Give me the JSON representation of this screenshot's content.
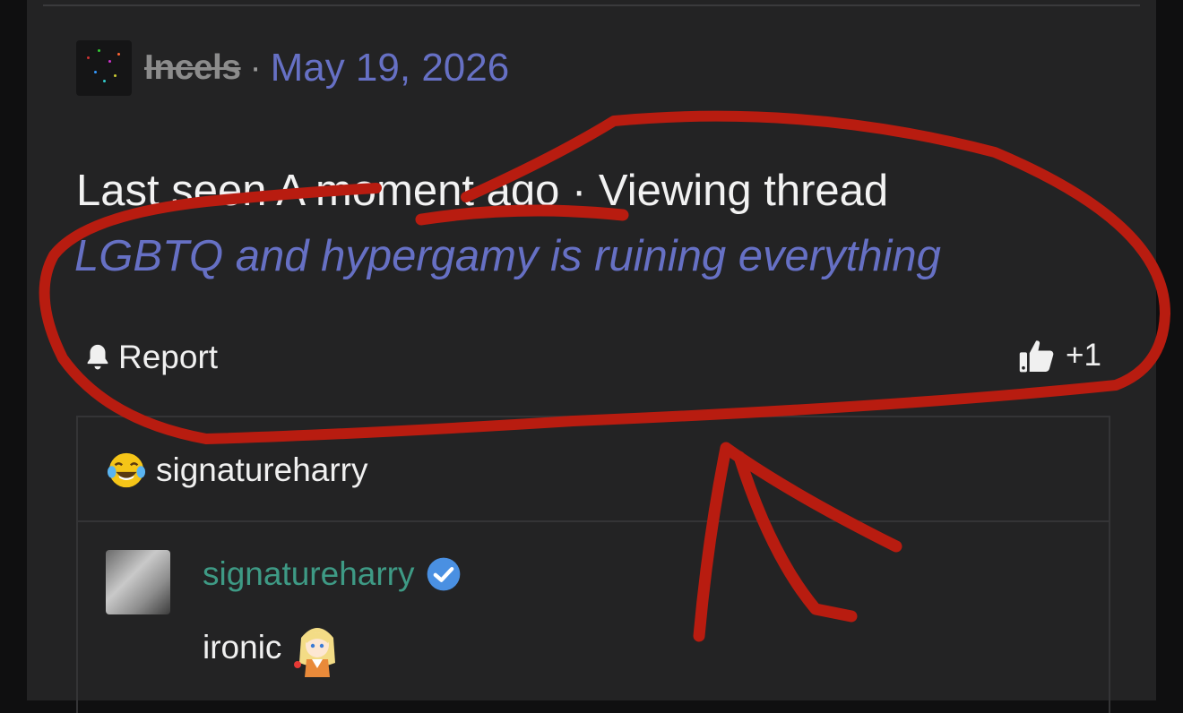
{
  "post": {
    "username": "Incels",
    "separator": "·",
    "date": "May 19, 2026",
    "status": "Last seen A moment ago · Viewing thread",
    "thread_title": "LGBTQ and hypergamy is ruining everything",
    "report_label": "Report",
    "like_count": "+1"
  },
  "reaction": {
    "emoji": "crying-laughing-face",
    "username": "signatureharry"
  },
  "comment": {
    "author": "signatureharry",
    "text": "ironic",
    "verified": true
  },
  "colors": {
    "background": "#232324",
    "link": "#6670c4",
    "author": "#3e9a85",
    "verified_badge": "#4a90e2",
    "annotation": "#b81c10"
  },
  "icons": [
    "bell-icon",
    "thumbs-up-icon",
    "verified-check-icon",
    "anime-sticker"
  ]
}
